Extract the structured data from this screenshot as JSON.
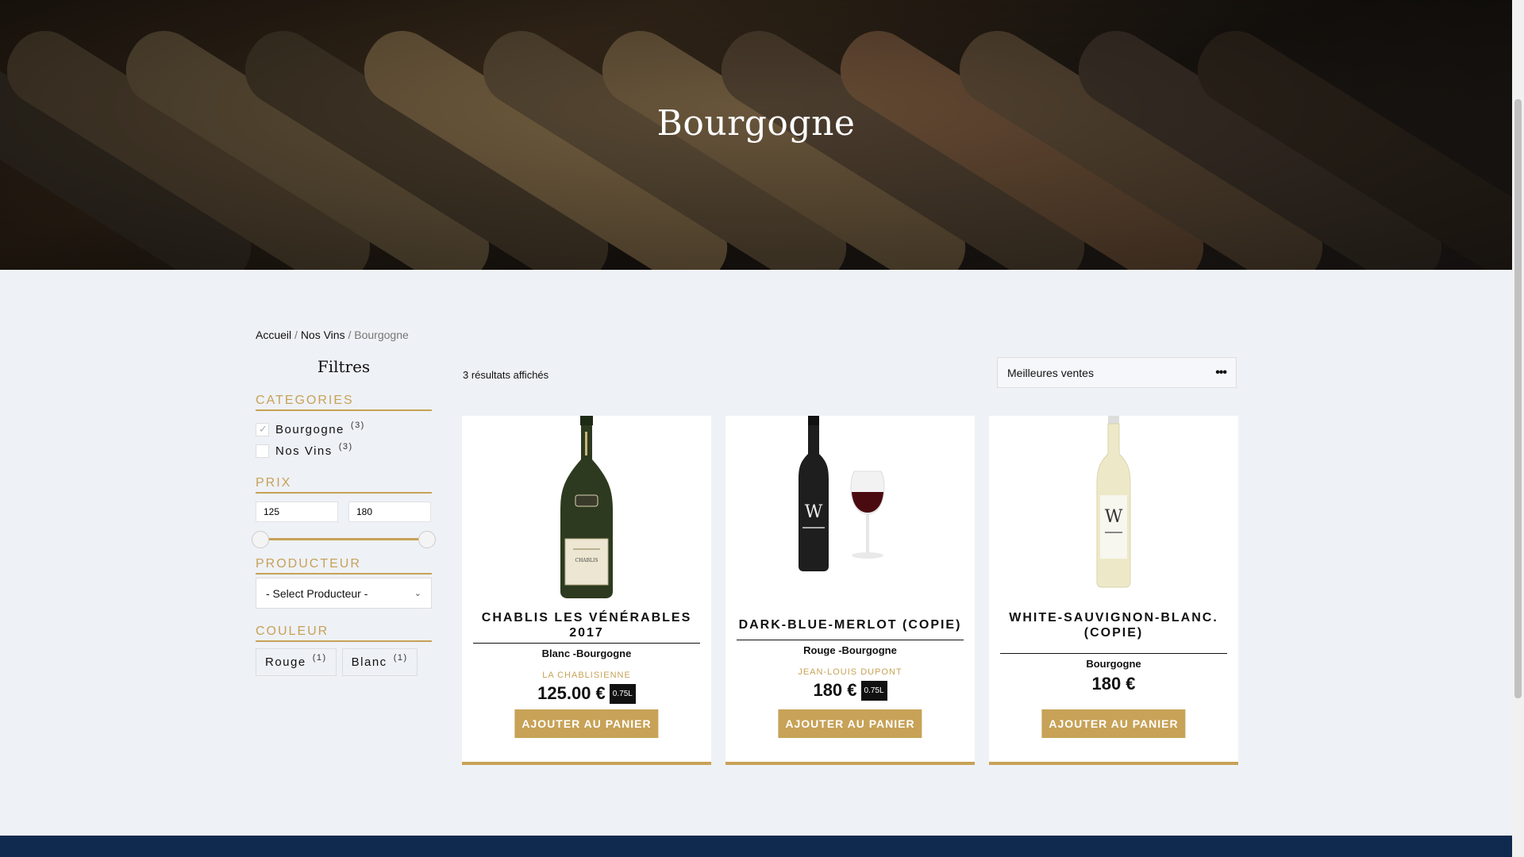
{
  "hero": {
    "title": "Bourgogne"
  },
  "breadcrumb": {
    "home": "Accueil",
    "sep1": " / ",
    "parent": "Nos Vins",
    "sep2": " / ",
    "current": "Bourgogne"
  },
  "filters": {
    "title": "Filtres",
    "categories": {
      "title": "CATEGORIES",
      "items": [
        {
          "label": "Bourgogne",
          "count": "(3)",
          "checked": true
        },
        {
          "label": "Nos Vins",
          "count": "(3)",
          "checked": false
        }
      ]
    },
    "price": {
      "title": "PRIX",
      "min_value": "125",
      "max_value": "180",
      "range_min_fraction": 0.0,
      "range_max_fraction": 1.0
    },
    "producer": {
      "title": "PRODUCTEUR",
      "selected": "- Select Producteur -"
    },
    "color": {
      "title": "COULEUR",
      "items": [
        {
          "label": "Rouge",
          "count": "(1)"
        },
        {
          "label": "Blanc",
          "count": "(1)"
        }
      ]
    }
  },
  "results": {
    "count_text": "3 résultats affichés",
    "sort_selected": "Meilleures ventes",
    "sort_icon": "more-dots-icon"
  },
  "products": [
    {
      "name": "CHABLIS LES VÉNÉRABLES 2017",
      "category": "Blanc -Bourgogne",
      "producer": "LA CHABLISIENNE",
      "price": "125.00 €",
      "volume": "0.75L",
      "button": "AJOUTER AU PANIER"
    },
    {
      "name": "DARK-BLUE-MERLOT (COPIE)",
      "category": "Rouge -Bourgogne",
      "producer": "JEAN-LOUIS DUPONT",
      "price": "180 €",
      "volume": "0.75L",
      "button": "AJOUTER AU PANIER"
    },
    {
      "name": "WHITE-SAUVIGNON-BLANC. (COPIE)",
      "category": "Bourgogne",
      "producer": "",
      "price": "180 €",
      "volume": "",
      "button": "AJOUTER AU PANIER"
    }
  ],
  "colors": {
    "accent": "#c7a257",
    "footer": "#0f2a4e",
    "background": "#eef1f6"
  }
}
